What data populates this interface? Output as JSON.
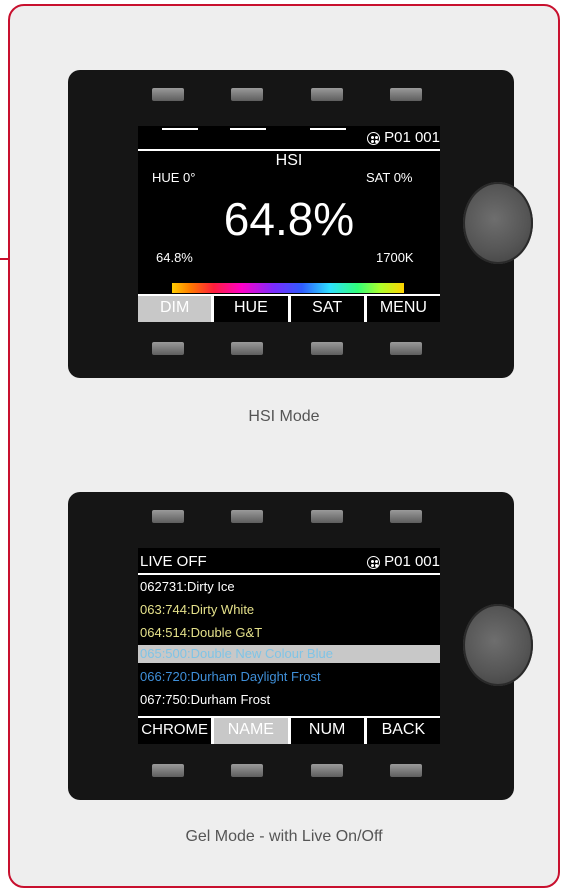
{
  "colors": {
    "frame_border": "#c8102e",
    "gel_yellow": "#e4e08a",
    "gel_cyan": "#7fc4e6",
    "gel_blue": "#3f8fd8",
    "highlight_row": "#c8c8c8"
  },
  "hsi": {
    "patch_icon": "dmx-connector-icon",
    "patch": "P01",
    "address": "001",
    "mode_title": "HSI",
    "hue_label": "HUE 0°",
    "sat_label": "SAT 0%",
    "intensity": "64.8%",
    "intensity_small": "64.8%",
    "cct": "1700K",
    "softkeys": [
      "DIM",
      "HUE",
      "SAT",
      "MENU"
    ],
    "active_softkey": "DIM",
    "caption": "HSI Mode"
  },
  "gel": {
    "live_label": "LIVE OFF",
    "patch_icon": "dmx-connector-icon",
    "patch": "P01",
    "address": "001",
    "items": [
      {
        "text": "062731:Dirty Ice",
        "color": "#ffffff"
      },
      {
        "text": "063:744:Dirty White",
        "color": "#e4e08a"
      },
      {
        "text": "064:514:Double G&T",
        "color": "#e4e08a"
      },
      {
        "text": "065:500:Double New Colour Blue",
        "color": "#7fc4e6",
        "selected": true
      },
      {
        "text": "066:720:Durham Daylight Frost",
        "color": "#3f8fd8"
      },
      {
        "text": "067:750:Durham Frost",
        "color": "#ffffff"
      }
    ],
    "softkeys": [
      "CHROME",
      "NAME",
      "NUM",
      "BACK"
    ],
    "active_softkey": "NAME",
    "caption": "Gel Mode - with Live On/Off"
  }
}
